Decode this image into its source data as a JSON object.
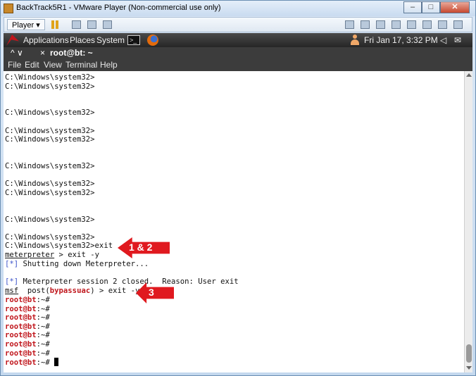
{
  "window": {
    "title": "BackTrack5R1 - VMware Player (Non-commercial use only)",
    "minimize": "–",
    "maximize": "□",
    "close": "✕"
  },
  "vm_toolbar": {
    "player_label": "Player ▾"
  },
  "panel": {
    "applications": "Applications",
    "places": "Places",
    "system": "System",
    "terminal_glyph": ">_",
    "datetime": "Fri Jan 17,  3:32 PM"
  },
  "terminal_tab": {
    "controls": "^   ∨",
    "close": "×",
    "title": "root@bt: ~"
  },
  "menu": [
    "File",
    "Edit",
    "View",
    "Terminal",
    "Help"
  ],
  "terminal": {
    "lines": [
      "C:\\Windows\\system32>",
      "C:\\Windows\\system32>",
      "",
      "",
      "C:\\Windows\\system32>",
      "",
      "C:\\Windows\\system32>",
      "C:\\Windows\\system32>",
      "",
      "",
      "C:\\Windows\\system32>",
      "",
      "C:\\Windows\\system32>",
      "C:\\Windows\\system32>",
      "",
      "",
      "C:\\Windows\\system32>",
      "",
      "C:\\Windows\\system32>",
      "C:\\Windows\\system32>exit"
    ],
    "meterpreter_prompt": "meterpreter",
    "meterpreter_cmd": " > exit -y",
    "info_marker": "[*]",
    "shutting_down": " Shutting down Meterpreter...",
    "session_closed": " Meterpreter session 2 closed.  Reason: User exit",
    "msf_prompt": "msf",
    "msf_post": "  post(",
    "msf_module": "bypassuac",
    "msf_cmd": ") > exit -y",
    "root_prompt": "root@bt",
    "root_suffix": ":~# ",
    "root_count": 8
  },
  "callouts": {
    "first": "1 & 2",
    "second": "3"
  }
}
